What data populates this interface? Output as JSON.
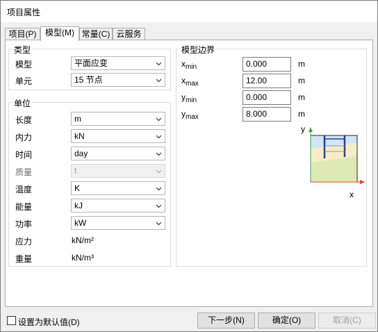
{
  "window": {
    "title": "项目属性"
  },
  "tabs": [
    {
      "label": "项目(P)"
    },
    {
      "label": "模型(M)"
    },
    {
      "label": "常量(C)"
    },
    {
      "label": "云服务"
    }
  ],
  "type_group": {
    "legend": "类型",
    "model_label": "模型",
    "model_value": "平面应变",
    "element_label": "单元",
    "element_value": "15 节点"
  },
  "units_group": {
    "legend": "单位",
    "length_label": "长度",
    "length_value": "m",
    "force_label": "内力",
    "force_value": "kN",
    "time_label": "时间",
    "time_value": "day",
    "mass_label": "质量",
    "mass_value": "t",
    "temperature_label": "温度",
    "temperature_value": "K",
    "energy_label": "能量",
    "energy_value": "kJ",
    "power_label": "功率",
    "power_value": "kW",
    "stress_label": "应力",
    "stress_value": "kN/m²",
    "unit_weight_label": "重量",
    "unit_weight_value": "kN/m³"
  },
  "bounds_group": {
    "legend": "模型边界",
    "xmin_base": "x",
    "xmin_sub": "min",
    "xmin_value": "0.000",
    "xmin_unit": "m",
    "xmax_base": "x",
    "xmax_sub": "max",
    "xmax_value": "12.00",
    "xmax_unit": "m",
    "ymin_base": "y",
    "ymin_sub": "min",
    "ymin_value": "0.000",
    "ymin_unit": "m",
    "ymax_base": "y",
    "ymax_sub": "max",
    "ymax_value": "8.000",
    "ymax_unit": "m",
    "axis_x_label": "x",
    "axis_y_label": "y"
  },
  "footer": {
    "default_checkbox_label": "设置为默认值(D)",
    "next_label": "下一步(N)",
    "ok_label": "确定(O)",
    "cancel_label": "取消(C)"
  },
  "colors": {
    "y_axis_arrow": "#43a047",
    "x_axis_arrow": "#e53935",
    "sky": "#cfe6f5",
    "soil": "#dfe9b6",
    "sand": "#f6edc4",
    "structure": "#2b3f8f"
  }
}
